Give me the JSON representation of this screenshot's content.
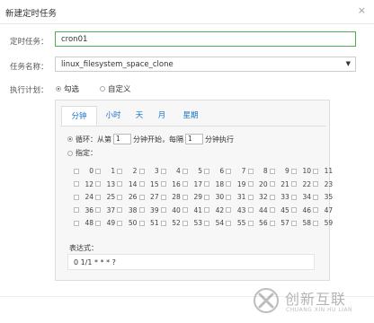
{
  "dialog": {
    "title": "新建定时任务",
    "close_label": "×"
  },
  "form": {
    "name_label": "定时任务：",
    "name_value": "cron01",
    "task_label": "任务名称：",
    "task_value": "linux_filesystem_space_clone",
    "plan_label": "执行计划：",
    "plan_options": [
      "勾选",
      "自定义"
    ],
    "plan_selected": "勾选"
  },
  "tabs": [
    "分钟",
    "小时",
    "天",
    "月",
    "星期"
  ],
  "active_tab": "分钟",
  "loop": {
    "label_prefix": "循环：从第",
    "start_value": "1",
    "label_mid": "分钟开始，每隔",
    "interval_value": "1",
    "label_suffix": "分钟执行"
  },
  "specify": {
    "label": "指定："
  },
  "minutes": [
    "0",
    "1",
    "2",
    "3",
    "4",
    "5",
    "6",
    "7",
    "8",
    "9",
    "10",
    "11",
    "12",
    "13",
    "14",
    "15",
    "16",
    "17",
    "18",
    "19",
    "20",
    "21",
    "22",
    "23",
    "24",
    "25",
    "26",
    "27",
    "28",
    "29",
    "30",
    "31",
    "32",
    "33",
    "34",
    "35",
    "36",
    "37",
    "38",
    "39",
    "40",
    "41",
    "42",
    "43",
    "44",
    "45",
    "46",
    "47",
    "48",
    "49",
    "50",
    "51",
    "52",
    "53",
    "54",
    "55",
    "56",
    "57",
    "58",
    "59"
  ],
  "expression": {
    "label": "表达式：",
    "value": "0 1/1 * * * ?"
  },
  "watermark": {
    "cn": "创新互联",
    "en": "CHUANG XIN HU LIAN"
  }
}
